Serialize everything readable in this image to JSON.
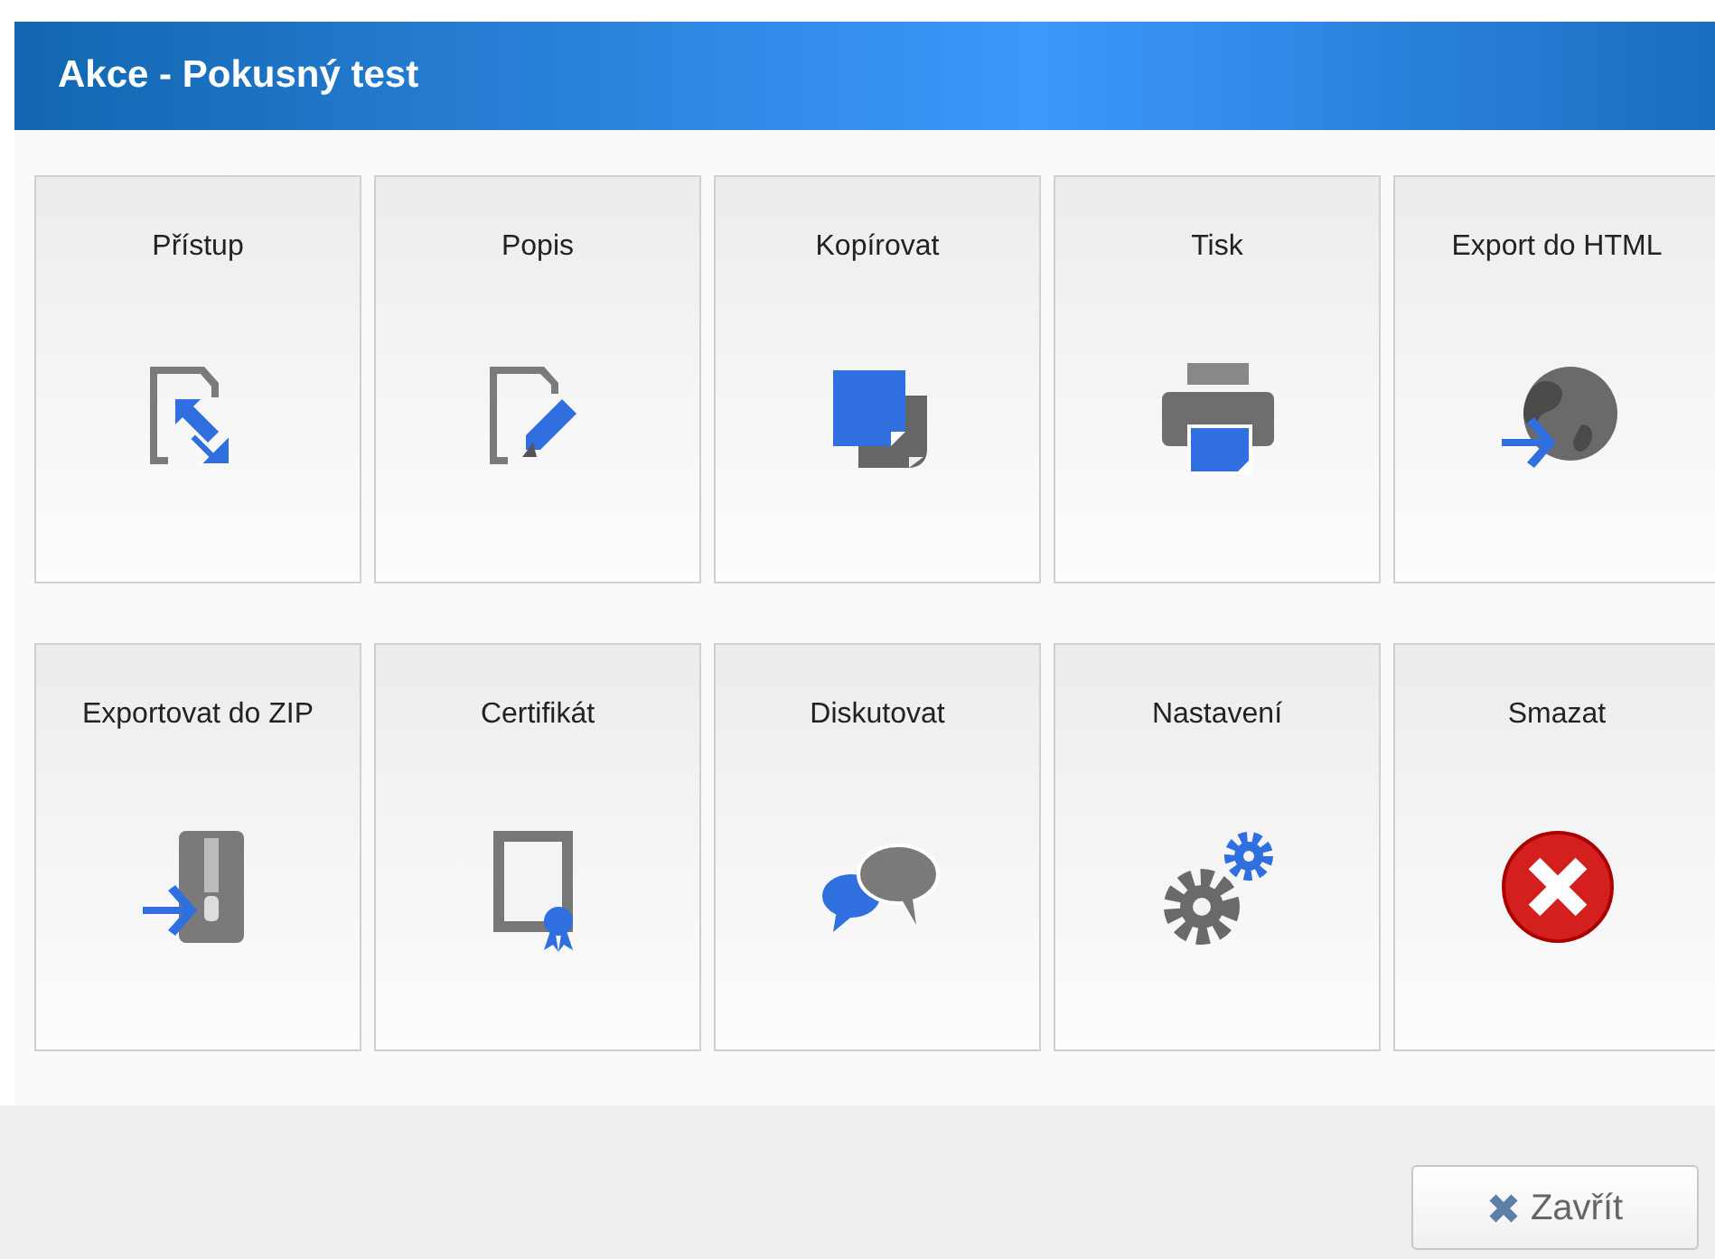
{
  "window": {
    "title": "Akce - Pokusný test"
  },
  "actions": [
    {
      "label": "Přístup",
      "kind": "access"
    },
    {
      "label": "Popis",
      "kind": "edit"
    },
    {
      "label": "Kopírovat",
      "kind": "copy"
    },
    {
      "label": "Tisk",
      "kind": "print"
    },
    {
      "label": "Export do HTML",
      "kind": "globe"
    },
    {
      "label": "Exportovat do ZIP",
      "kind": "zip"
    },
    {
      "label": "Certifikát",
      "kind": "certificate"
    },
    {
      "label": "Diskutovat",
      "kind": "discuss"
    },
    {
      "label": "Nastavení",
      "kind": "settings"
    },
    {
      "label": "Smazat",
      "kind": "delete"
    }
  ],
  "buttons": [
    {
      "label": "Zavřít",
      "kind": "close"
    }
  ]
}
